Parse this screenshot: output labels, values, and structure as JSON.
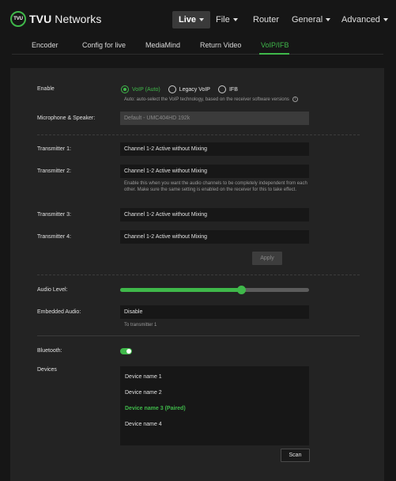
{
  "brand": {
    "mark": "TVU",
    "name_bold": "TVU",
    "name_rest": " Networks",
    "accent": "#3fb84a"
  },
  "topnav": [
    {
      "label": "Live",
      "dropdown": true,
      "active": true
    },
    {
      "label": "File",
      "dropdown": true,
      "active": false
    },
    {
      "label": "Router",
      "dropdown": false,
      "active": false
    },
    {
      "label": "General",
      "dropdown": true,
      "active": false
    },
    {
      "label": "Advanced",
      "dropdown": true,
      "active": false
    }
  ],
  "subnav": [
    {
      "label": "Encoder",
      "active": false
    },
    {
      "label": "Config for live",
      "active": false
    },
    {
      "label": "MediaMind",
      "active": false
    },
    {
      "label": "Return Video",
      "active": false
    },
    {
      "label": "VoIP/IFB",
      "active": true
    }
  ],
  "form": {
    "enable": {
      "label": "Enable",
      "options": [
        {
          "label": "VoIP (Auto)",
          "selected": true
        },
        {
          "label": "Legacy VoIP",
          "selected": false
        },
        {
          "label": "IFB",
          "selected": false
        }
      ],
      "hint": "Auto: auto-select the VoIP technology, based on the receiver software versions"
    },
    "mic_speaker": {
      "label": "Microphone & Speaker:",
      "value": "Default - UMC404HD 192k"
    },
    "transmitters": [
      {
        "label": "Transmitter 1:",
        "value": "Channel 1-2 Active without Mixing"
      },
      {
        "label": "Transmitter 2:",
        "value": "Channel 1-2 Active without Mixing"
      },
      {
        "label": "Transmitter 3:",
        "value": "Channel 1-2 Active without Mixing"
      },
      {
        "label": "Transmitter 4:",
        "value": "Channel 1-2 Active without Mixing"
      }
    ],
    "transmitter_hint": "Enable this when you want the audio channels to be completely independent from each other. Make sure the same setting is enabled on the receiver for this to take effect.",
    "apply_label": "Apply",
    "audio_level": {
      "label": "Audio Level:",
      "value_fraction": 0.64
    },
    "embedded_audio": {
      "label": "Embedded Audio:",
      "value": "Disable",
      "hint": "To transmitter 1"
    },
    "bluetooth": {
      "label": "Bluetooth:",
      "enabled": true
    },
    "devices": {
      "label": "Devices",
      "items": [
        {
          "name": "Device name 1",
          "paired": false
        },
        {
          "name": "Device name 2",
          "paired": false
        },
        {
          "name": "Device name 3 (Paired)",
          "paired": true
        },
        {
          "name": "Device name 4",
          "paired": false
        }
      ]
    },
    "scan_label": "Scan"
  }
}
